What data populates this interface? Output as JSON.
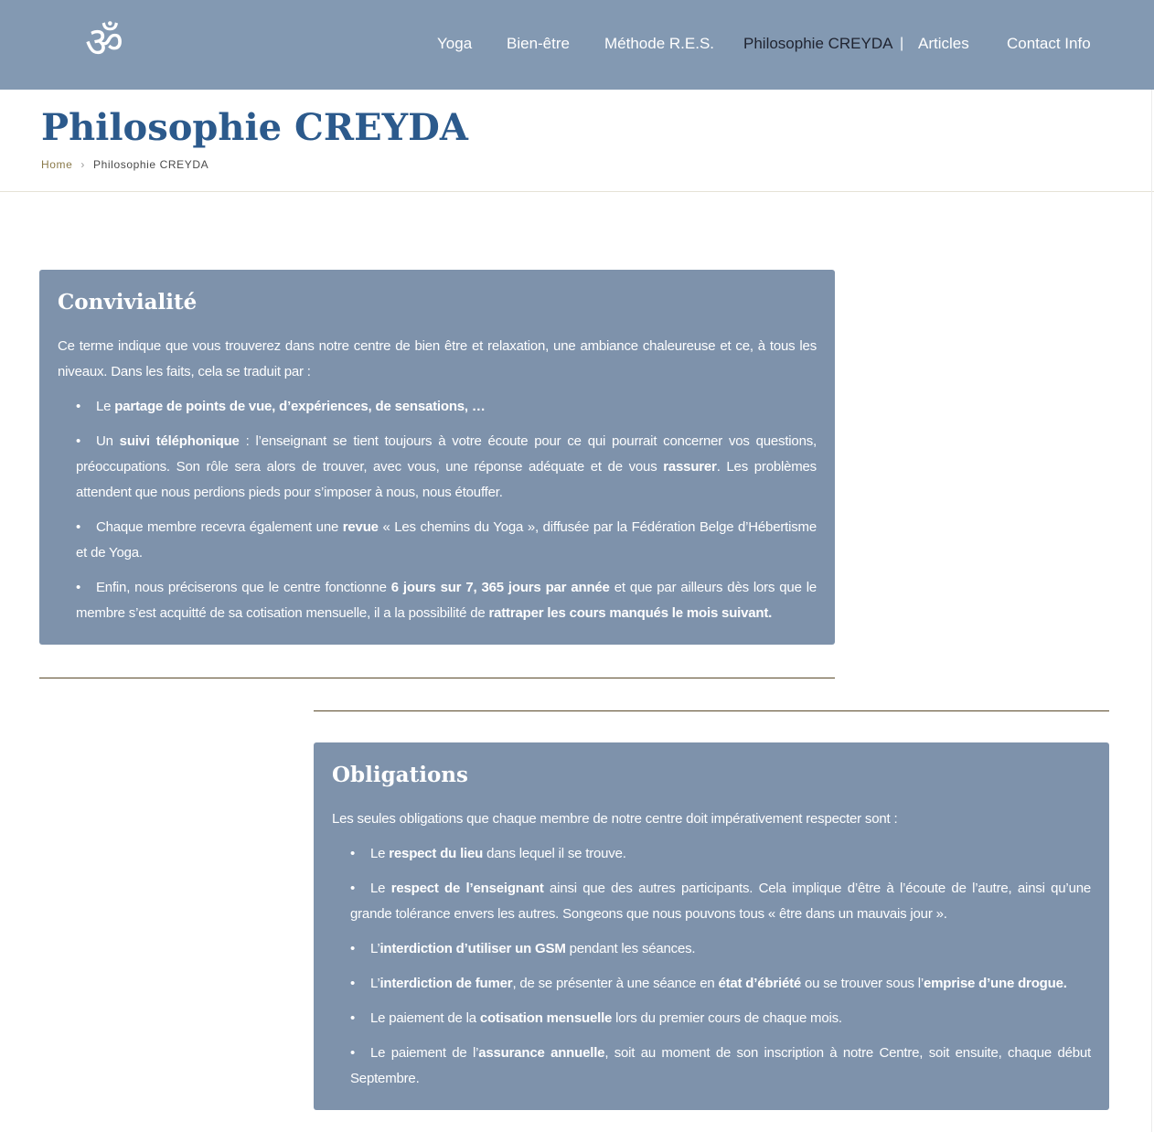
{
  "header": {
    "logo_glyph": "ॐ",
    "nav": [
      "Yoga",
      "Bien-être",
      "Méthode R.E.S.",
      "Philosophie CREYDA",
      "Articles",
      "Contact Info"
    ],
    "separator": "|",
    "active_index": 3
  },
  "page": {
    "title": "Philosophie CREYDA",
    "breadcrumb": {
      "home": "Home",
      "arrow": "›",
      "current": "Philosophie CREYDA"
    }
  },
  "convivialite": {
    "heading": "Convivialité",
    "intro": "Ce terme indique que vous trouverez dans notre centre de bien être et relaxation, une ambiance chaleureuse et ce, à tous les niveaux. Dans les faits, cela se traduit par :",
    "bullet": "•",
    "item1": {
      "a": "Le ",
      "b": "partage de points de vue, d’expériences, de sensations, …"
    },
    "item2": {
      "a": "Un ",
      "b": "suivi téléphonique",
      "c": " : l’enseignant se tient toujours à votre écoute pour ce qui pourrait concerner vos questions, préoccupations. Son rôle sera alors de trouver, avec vous, une réponse adéquate et de vous ",
      "d": "rassurer",
      "e": ". Les problèmes attendent que nous perdions pieds pour s’imposer à nous, nous étouffer."
    },
    "item3": {
      "a": "Chaque membre recevra également une ",
      "b": "revue",
      "c": " « Les chemins du Yoga », diffusée par la Fédération Belge d’Hébertisme et de Yoga."
    },
    "item4": {
      "a": "Enfin, nous préciserons que le centre fonctionne ",
      "b": "6 jours sur 7, 365 jours par année",
      "c": " et que par ailleurs dès lors que le membre s’est acquitté de sa cotisation mensuelle, il a la possibilité de ",
      "d": "rattraper les cours manqués le mois suivant."
    }
  },
  "obligations": {
    "heading": "Obligations",
    "intro": "Les seules obligations que chaque membre de notre centre doit impérativement respecter sont :",
    "bullet": "•",
    "item1": {
      "a": "Le ",
      "b": "respect du lieu",
      "c": " dans lequel il se trouve."
    },
    "item2": {
      "a": "Le ",
      "b": "respect de l’enseignant",
      "c": " ainsi que des autres participants. Cela implique d’être à l’écoute de l’autre, ainsi qu’une grande tolérance envers les autres. Songeons que nous pouvons tous « être dans un mauvais jour »."
    },
    "item3": {
      "a": "L’",
      "b": "interdiction d’utiliser un GSM",
      "c": " pendant les séances."
    },
    "item4": {
      "a": "L’",
      "b": "interdiction de fumer",
      "c": ", de se présenter à une séance en ",
      "d": "état d’ébriété",
      "e": " ou se trouver sous l’",
      "f": "emprise d’une drogue."
    },
    "item5": {
      "a": "Le paiement de la ",
      "b": "cotisation mensuelle",
      "c": " lors du premier cours de chaque mois."
    },
    "item6": {
      "a": "Le paiement de l’",
      "b": "assurance annuelle",
      "c": ", soit au moment de son inscription à notre Centre, soit ensuite, chaque début Septembre."
    }
  },
  "colors": {
    "header_bg": "#8399b2",
    "card_bg": "#7e92ab",
    "title": "#2c5a8c",
    "active_nav": "#1f2330"
  }
}
